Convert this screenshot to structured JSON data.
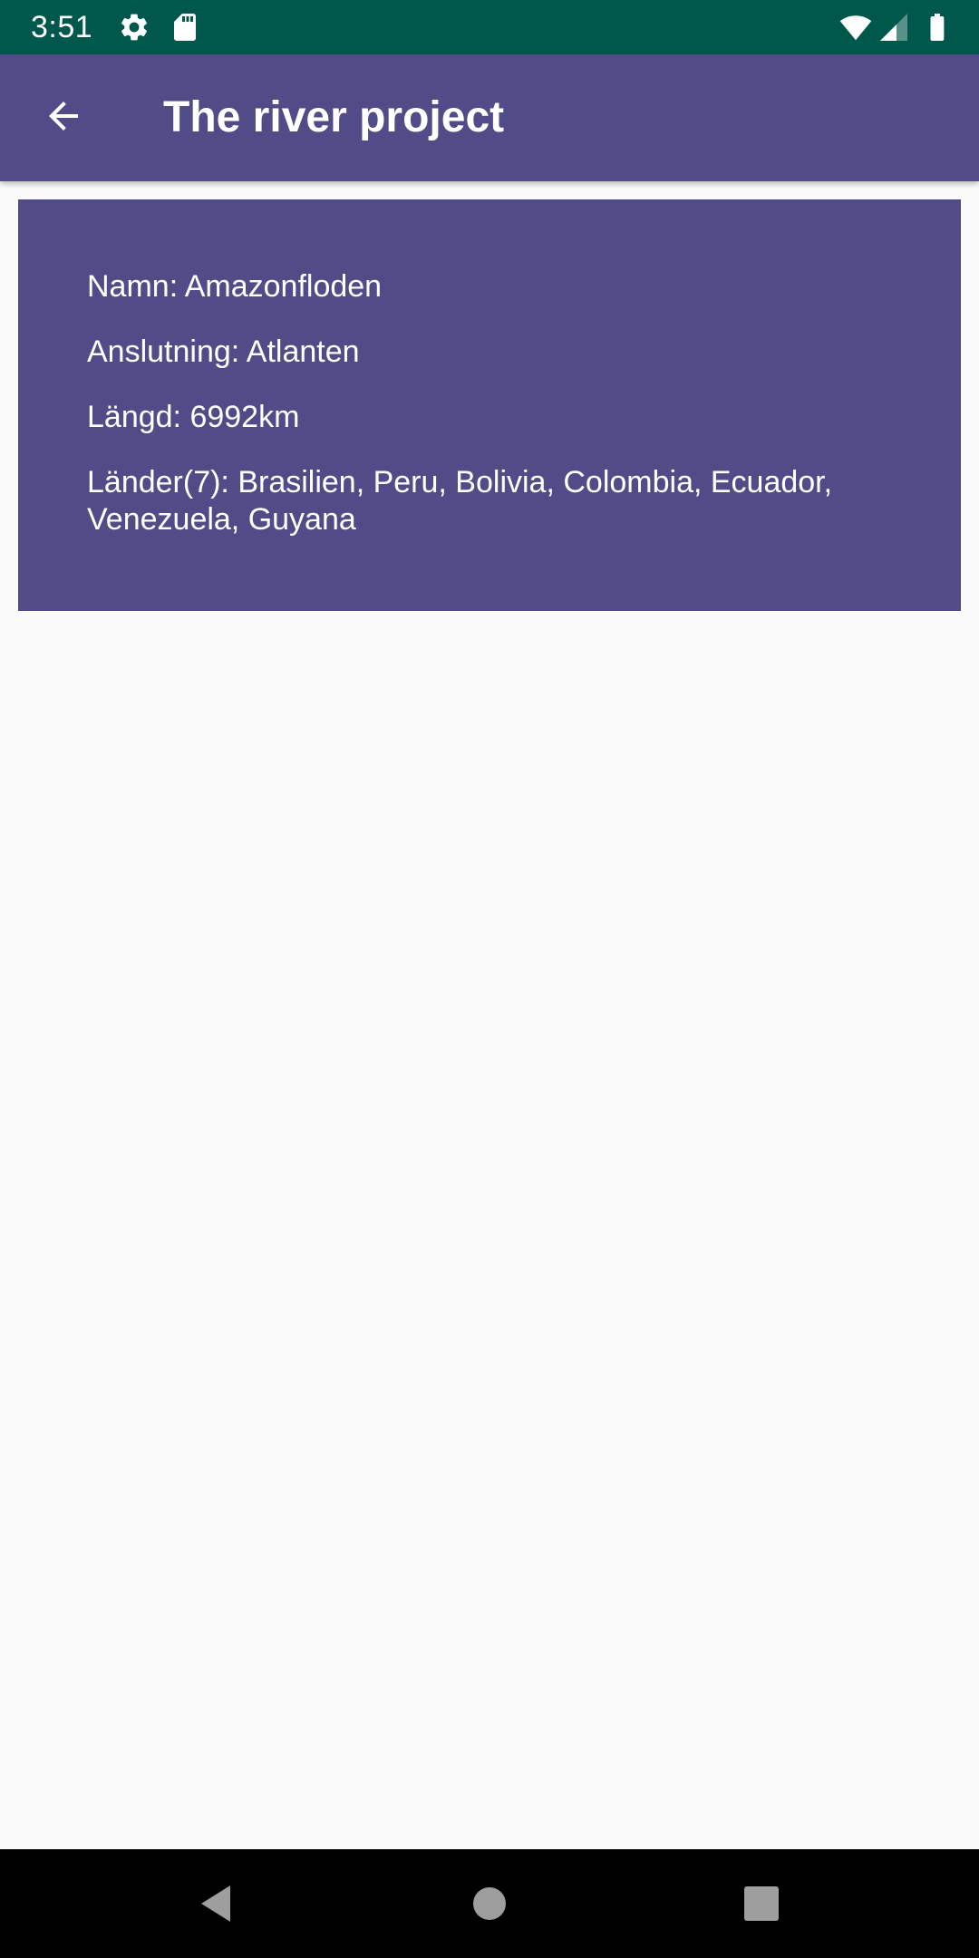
{
  "status_bar": {
    "time": "3:51",
    "icons": [
      "settings-icon",
      "sd-card-icon",
      "wifi-icon",
      "cell-signal-icon",
      "battery-icon"
    ],
    "background_color": "#00574b"
  },
  "app_bar": {
    "title": "The river project",
    "back_icon": "arrow-back-icon",
    "background_color": "#514c88"
  },
  "river": {
    "name": "Namn: Amazonfloden",
    "connection": "Anslutning: Atlanten",
    "length": "Längd: 6992km",
    "countries": "Länder(7): Brasilien, Peru, Bolivia, Colombia, Ecuador, Venezuela, Guyana"
  },
  "nav_bar": {
    "icons": [
      "nav-back-icon",
      "nav-home-icon",
      "nav-recents-icon"
    ]
  }
}
